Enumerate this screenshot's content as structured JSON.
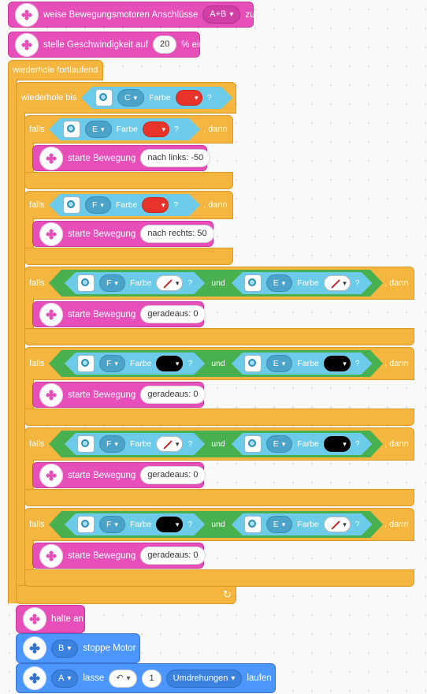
{
  "motors_block": {
    "text": "weise Bewegungsmotoren Anschlüsse",
    "ports": "A+B",
    "suffix": "zu"
  },
  "speed_block": {
    "text": "stelle Geschwindigkeit auf",
    "value": "20",
    "unit": "% ein"
  },
  "forever_label": "wiederhole fortlaufend",
  "repeat_until": {
    "label": "wiederhole bis",
    "port": "C",
    "word": "Farbe",
    "q": "?"
  },
  "sensor_word": "Farbe",
  "question": "?",
  "and_word": "und",
  "if_label": "falls",
  "then_label": ", dann",
  "start_move": "starte Bewegung",
  "conditions": [
    {
      "port": "E",
      "color": "red",
      "action": "nach links: -50"
    },
    {
      "port": "F",
      "color": "red",
      "action": "nach rechts: 50"
    },
    {
      "port1": "F",
      "color1": "none",
      "port2": "E",
      "color2": "none",
      "action": "geradeaus: 0"
    },
    {
      "port1": "F",
      "color1": "black",
      "port2": "E",
      "color2": "black",
      "action": "geradeaus: 0"
    },
    {
      "port1": "F",
      "color1": "none",
      "port2": "E",
      "color2": "black",
      "action": "geradeaus: 0"
    },
    {
      "port1": "F",
      "color1": "black",
      "port2": "E",
      "color2": "none",
      "action": "geradeaus: 0"
    }
  ],
  "stop_all": "halte an",
  "stop_motor": {
    "port": "B",
    "text": "stoppe Motor"
  },
  "run_motor": {
    "port": "A",
    "text": "lasse",
    "value": "1",
    "unit": "Umdrehungen",
    "suffix": "laufen"
  },
  "colors": {
    "pink": "#e64fb9",
    "blue": "#4c97ff",
    "control": "#f4b63f",
    "sensor": "#6ccbe8",
    "operator": "#48b04e"
  }
}
